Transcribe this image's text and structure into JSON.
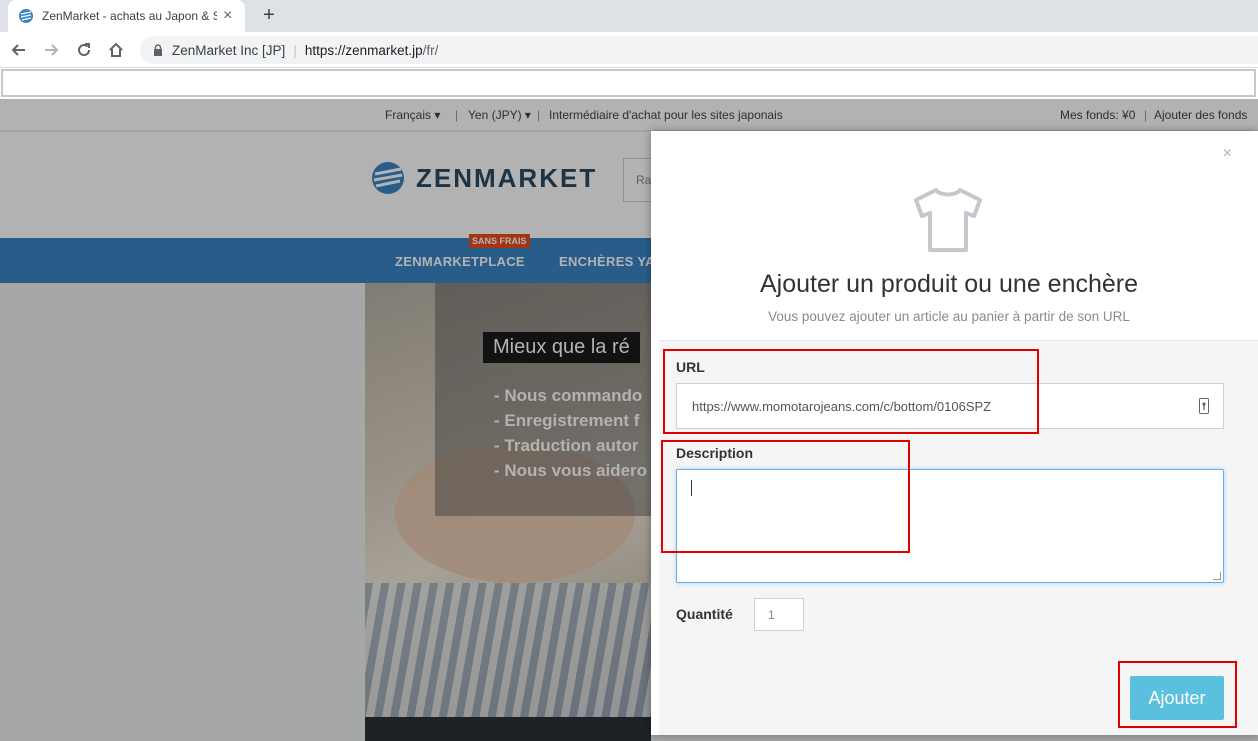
{
  "browser": {
    "tab_title": "ZenMarket - achats au Japon & S",
    "omnibox_site": "ZenMarket Inc [JP]",
    "omnibox_host": "https://zenmarket.jp",
    "omnibox_path": "/fr/"
  },
  "page": {
    "topbar": {
      "language": "Français ▾",
      "currency": "Yen (JPY) ▾",
      "info": "Intermédiaire d'achat pour les sites japonais",
      "funds": "Mes fonds: ¥0",
      "add_funds": "Ajouter des fonds"
    },
    "logo": "ZENMARKET",
    "search_placeholder": "Ra",
    "nav": {
      "badge": "SANS FRAIS",
      "items": [
        "ZENMARKETPLACE",
        "ENCHÈRES YA"
      ]
    },
    "hero": {
      "title": "Mieux que la ré",
      "bullets": [
        "- Nous commando",
        "- Enregistrement f",
        "- Traduction autor",
        "- Nous vous aidero"
      ]
    }
  },
  "modal": {
    "close": "×",
    "title": "Ajouter un produit ou une enchère",
    "subtitle": "Vous pouvez ajouter un article au panier à partir de son URL",
    "url_label": "URL",
    "url_value": "https://www.momotarojeans.com/c/bottom/0106SPZ",
    "description_label": "Description",
    "quantity_label": "Quantité",
    "quantity_value": "1",
    "submit_label": "Ajouter"
  },
  "colors": {
    "nav_blue": "#3c86c4",
    "button_blue": "#5bc0de",
    "highlight_red": "#e00000",
    "badge_orange": "#e84c1e"
  }
}
